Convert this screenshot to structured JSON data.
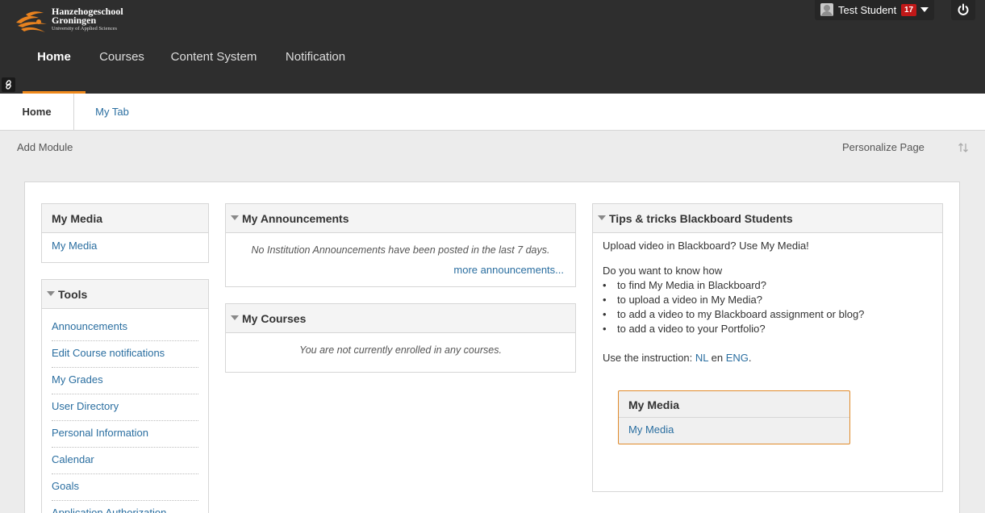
{
  "header": {
    "logo": {
      "name_line1": "Hanzehogeschool",
      "name_line2": "Groningen",
      "subtitle": "University of Applied Sciences"
    },
    "user": {
      "name": "Test Student",
      "notification_count": "17",
      "avatar_icon": "user-avatar-icon",
      "menu_icon": "chevron-down-icon"
    },
    "logout_icon": "power-icon",
    "nav": [
      {
        "label": "Home",
        "active": true
      },
      {
        "label": "Courses",
        "active": false
      },
      {
        "label": "Content System",
        "active": false
      },
      {
        "label": "Notification",
        "active": false
      }
    ],
    "link_icon": "link-icon"
  },
  "tabs": [
    {
      "label": "Home",
      "active": true
    },
    {
      "label": "My Tab",
      "active": false
    }
  ],
  "page_actions": {
    "add_module": "Add Module",
    "personalize": "Personalize Page",
    "reorder_icon": "reorder-arrows-icon"
  },
  "modules": {
    "my_media": {
      "title": "My Media",
      "link": "My Media"
    },
    "tools": {
      "title": "Tools",
      "items": [
        "Announcements",
        "Edit Course notifications",
        "My Grades",
        "User Directory",
        "Personal Information",
        "Calendar",
        "Goals",
        "Application Authorization"
      ]
    },
    "announcements": {
      "title": "My Announcements",
      "empty_text": "No Institution Announcements have been posted in the last 7 days.",
      "more_link": "more announcements..."
    },
    "courses": {
      "title": "My Courses",
      "empty_text": "You are not currently enrolled in any courses."
    },
    "tips": {
      "title": "Tips & tricks Blackboard Students",
      "intro": "Upload video in Blackboard? Use My Media!",
      "question": "Do you want to know how",
      "bullets": [
        "to find My Media in Blackboard?",
        "to upload a video in My Media?",
        "to add a video to my Blackboard assignment or blog?",
        "to add a video to your Portfolio?"
      ],
      "bullet_char": "•",
      "instruction_prefix": "Use the instruction: ",
      "instruction_nl": "NL",
      "instruction_mid": " en ",
      "instruction_eng": "ENG",
      "instruction_suffix": ".",
      "inner_title": "My Media",
      "inner_link": "My Media"
    }
  },
  "colors": {
    "header_bg": "#2e2e2e",
    "accent_orange": "#f08a1c",
    "link_blue": "#2a6ea0",
    "badge_red": "#c01818"
  }
}
